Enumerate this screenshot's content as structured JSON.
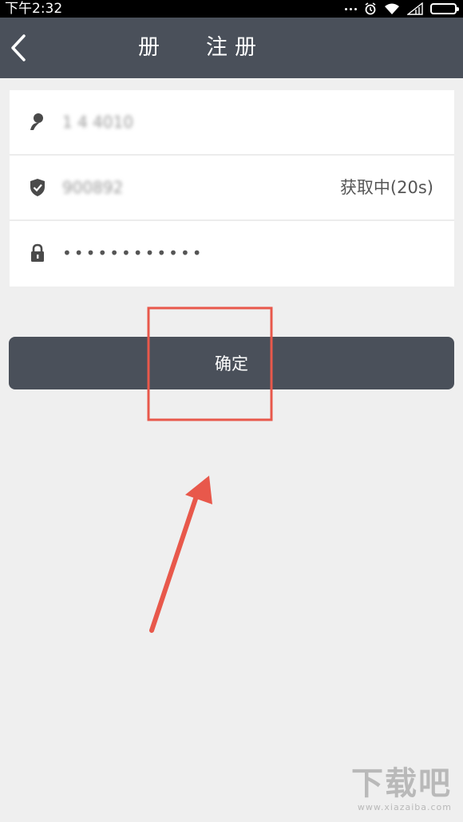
{
  "status_bar": {
    "time": "下午2:32",
    "icons": [
      "more-dots-icon",
      "alarm-icon",
      "wifi-icon",
      "signal-icon",
      "battery-icon"
    ]
  },
  "nav": {
    "back_icon": "chevron-left-icon",
    "left_char": "册",
    "title": "注册"
  },
  "form": {
    "phone": {
      "icon": "user-icon",
      "value": "1 4 4010"
    },
    "code": {
      "icon": "shield-icon",
      "value": "900892",
      "status": "获取中(20s)"
    },
    "password": {
      "icon": "lock-icon",
      "value": "••••••••••••"
    }
  },
  "confirm_label": "确定",
  "watermark": {
    "text": "下载吧",
    "url": "www.xiazaiba.com"
  },
  "colors": {
    "nav_bg": "#4a505a",
    "button_bg": "#4a505a",
    "page_bg": "#efefef",
    "annotation": "#e8584b"
  }
}
